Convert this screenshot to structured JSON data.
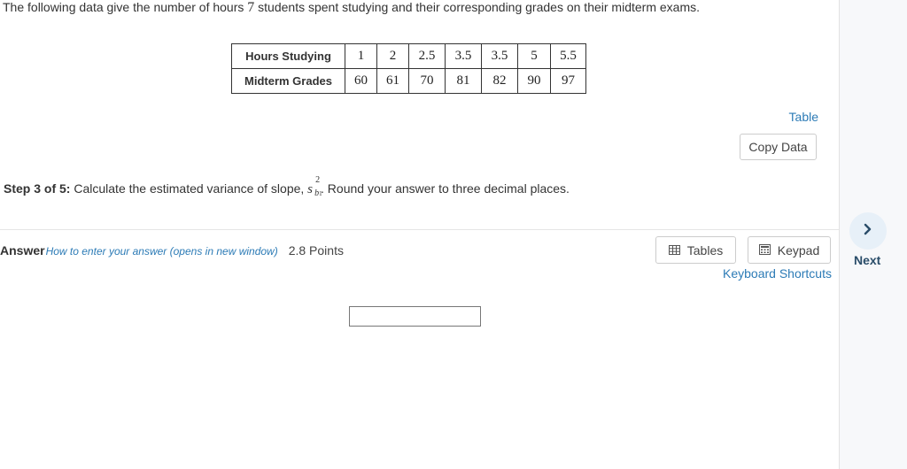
{
  "question": {
    "intro_before": "The following data give the number of hours ",
    "intro_count": "7",
    "intro_after": " students spent studying and their corresponding grades on their midterm exams."
  },
  "data_table": {
    "row_headers": [
      "Hours Studying",
      "Midterm Grades"
    ],
    "hours": [
      "1",
      "2",
      "2.5",
      "3.5",
      "3.5",
      "5",
      "5.5"
    ],
    "grades": [
      "60",
      "61",
      "70",
      "81",
      "82",
      "90",
      "97"
    ]
  },
  "table_link": "Table",
  "copy_data_label": "Copy Data",
  "step": {
    "label": "Step 3 of 5:",
    "text_before": " Calculate the estimated variance of slope, ",
    "symbol": "s",
    "superscript": "2",
    "subscript_base": "b",
    "subscript_index": "1",
    "text_after": ". Round your answer to three decimal places."
  },
  "answer": {
    "label": "Answer",
    "help_link": "How to enter your answer (opens in new window)",
    "points": "2.8 Points",
    "value": ""
  },
  "tools": {
    "tables_label": "Tables",
    "keypad_label": "Keypad",
    "shortcuts_link": "Keyboard Shortcuts"
  },
  "nav": {
    "next_label": "Next",
    "next_icon": "chevron-right-icon"
  },
  "colors": {
    "link": "#2c7bb6",
    "next_label": "#2a4d69",
    "next_circle": "#e7f0f8"
  }
}
